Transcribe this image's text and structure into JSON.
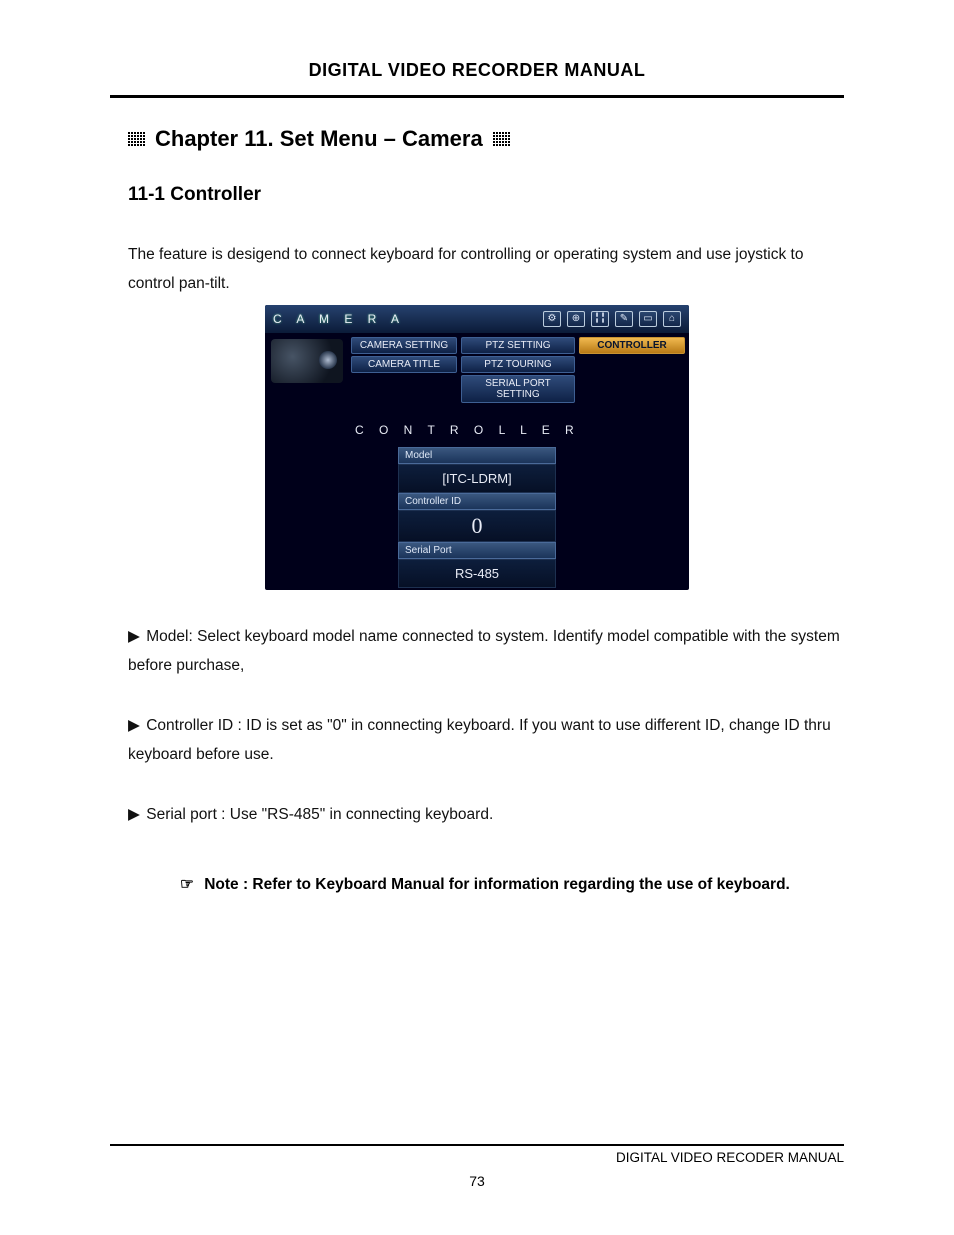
{
  "header": {
    "title": "DIGITAL VIDEO RECORDER MANUAL"
  },
  "chapter": {
    "title": "Chapter 11. Set Menu – Camera"
  },
  "section": {
    "title": "11-1 Controller"
  },
  "intro": "The feature is desigend to connect keyboard for controlling or operating system and use joystick to control pan-tilt.",
  "screenshot": {
    "title": "C A M E R A",
    "icons": [
      "gear",
      "schedule",
      "controls",
      "draw",
      "monitor",
      "home"
    ],
    "tabs": {
      "col1": [
        "CAMERA SETTING",
        "CAMERA TITLE"
      ],
      "col2": [
        "PTZ SETTING",
        "PTZ TOURING",
        "SERIAL PORT SETTING"
      ],
      "col3": [
        "CONTROLLER"
      ]
    },
    "panel_label": "C O N T R O L L E R",
    "fields": [
      {
        "label": "Model",
        "value": "[ITC-LDRM]"
      },
      {
        "label": "Controller ID",
        "value": "0"
      },
      {
        "label": "Serial Port",
        "value": "RS-485"
      }
    ]
  },
  "bullets": [
    "Model: Select keyboard model name connected to system. Identify model compatible with the system before purchase,",
    "Controller ID : ID is set as \"0\" in connecting keyboard. If you want to use different ID, change ID thru keyboard before use.",
    "Serial port : Use \"RS-485\" in connecting keyboard."
  ],
  "note": "Note : Refer to Keyboard Manual for information regarding the use of keyboard.",
  "footer": {
    "text": "DIGITAL VIDEO RECODER MANUAL",
    "page": "73"
  }
}
